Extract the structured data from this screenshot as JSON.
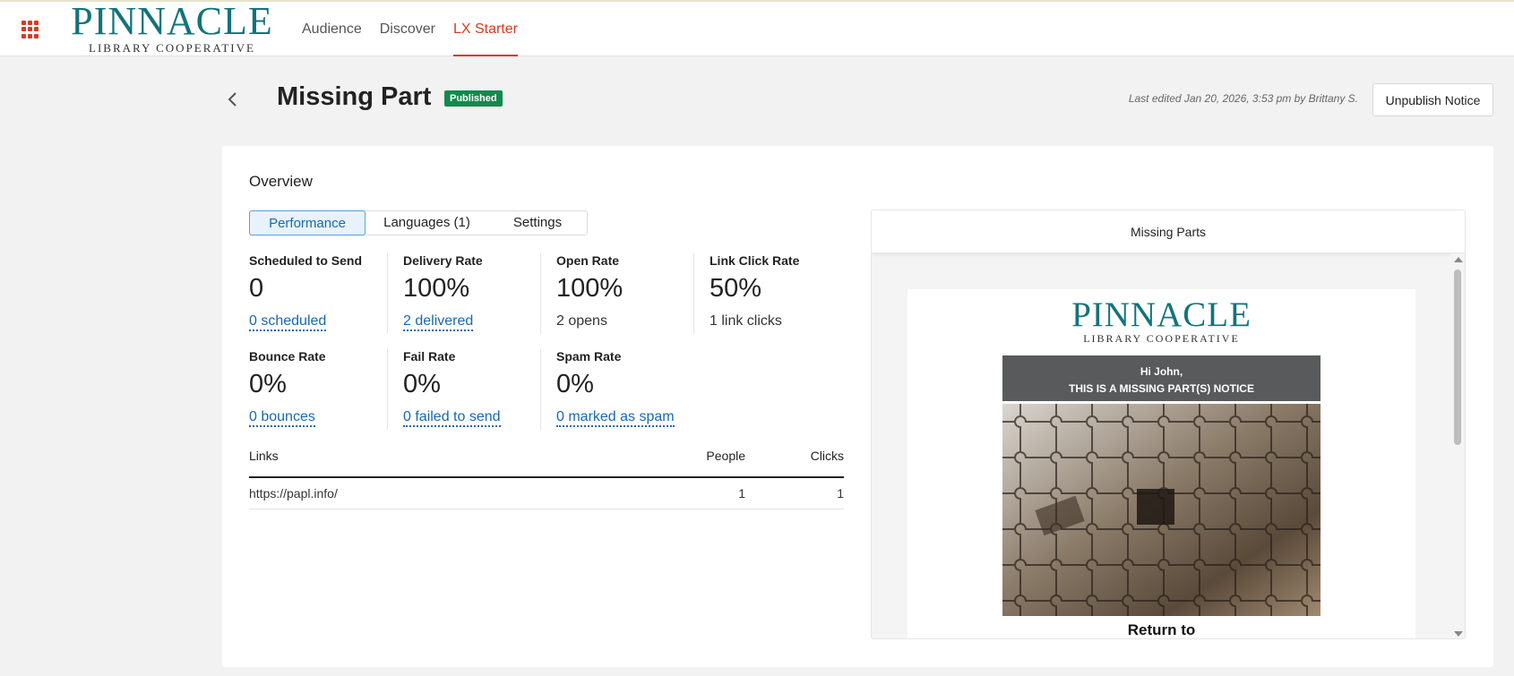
{
  "topbar": {
    "logo_main": "PINNACLE",
    "logo_sub": "LIBRARY COOPERATIVE",
    "nav": [
      {
        "label": "Audience"
      },
      {
        "label": "Discover"
      },
      {
        "label": "LX Starter"
      }
    ],
    "active_nav": "LX Starter"
  },
  "header": {
    "title": "Missing Part",
    "status_badge": "Published",
    "last_edited": "Last edited Jan 20, 2026, 3:53 pm by Brittany  S.",
    "unpublish_label": "Unpublish Notice"
  },
  "overview": {
    "title": "Overview",
    "tabs": [
      {
        "label": "Performance"
      },
      {
        "label": "Languages (1)"
      },
      {
        "label": "Settings"
      }
    ],
    "active_tab": "Performance",
    "metrics": {
      "scheduled": {
        "label": "Scheduled to Send",
        "value": "0",
        "detail": "0 scheduled"
      },
      "delivery": {
        "label": "Delivery Rate",
        "value": "100%",
        "detail": "2 delivered"
      },
      "open": {
        "label": "Open Rate",
        "value": "100%",
        "detail": "2 opens"
      },
      "link_click": {
        "label": "Link Click Rate",
        "value": "50%",
        "detail": "1 link clicks"
      },
      "bounce": {
        "label": "Bounce Rate",
        "value": "0%",
        "detail": "0 bounces"
      },
      "fail": {
        "label": "Fail Rate",
        "value": "0%",
        "detail": "0 failed to send"
      },
      "spam": {
        "label": "Spam Rate",
        "value": "0%",
        "detail": "0 marked as spam"
      }
    },
    "links_table": {
      "headers": {
        "link": "Links",
        "people": "People",
        "clicks": "Clicks"
      },
      "rows": [
        {
          "link": "https://papl.info/",
          "people": "1",
          "clicks": "1"
        }
      ]
    }
  },
  "preview": {
    "title": "Missing Parts",
    "email": {
      "logo_main": "PINNACLE",
      "logo_sub": "LIBRARY COOPERATIVE",
      "greeting": "Hi John,",
      "banner_text": "THIS IS A MISSING PART(S) NOTICE",
      "heading": "Return to"
    }
  },
  "colors": {
    "brand_teal": "#13737b",
    "accent_red": "#d83a1f",
    "link_blue": "#1767b4",
    "badge_green": "#138a4c"
  }
}
